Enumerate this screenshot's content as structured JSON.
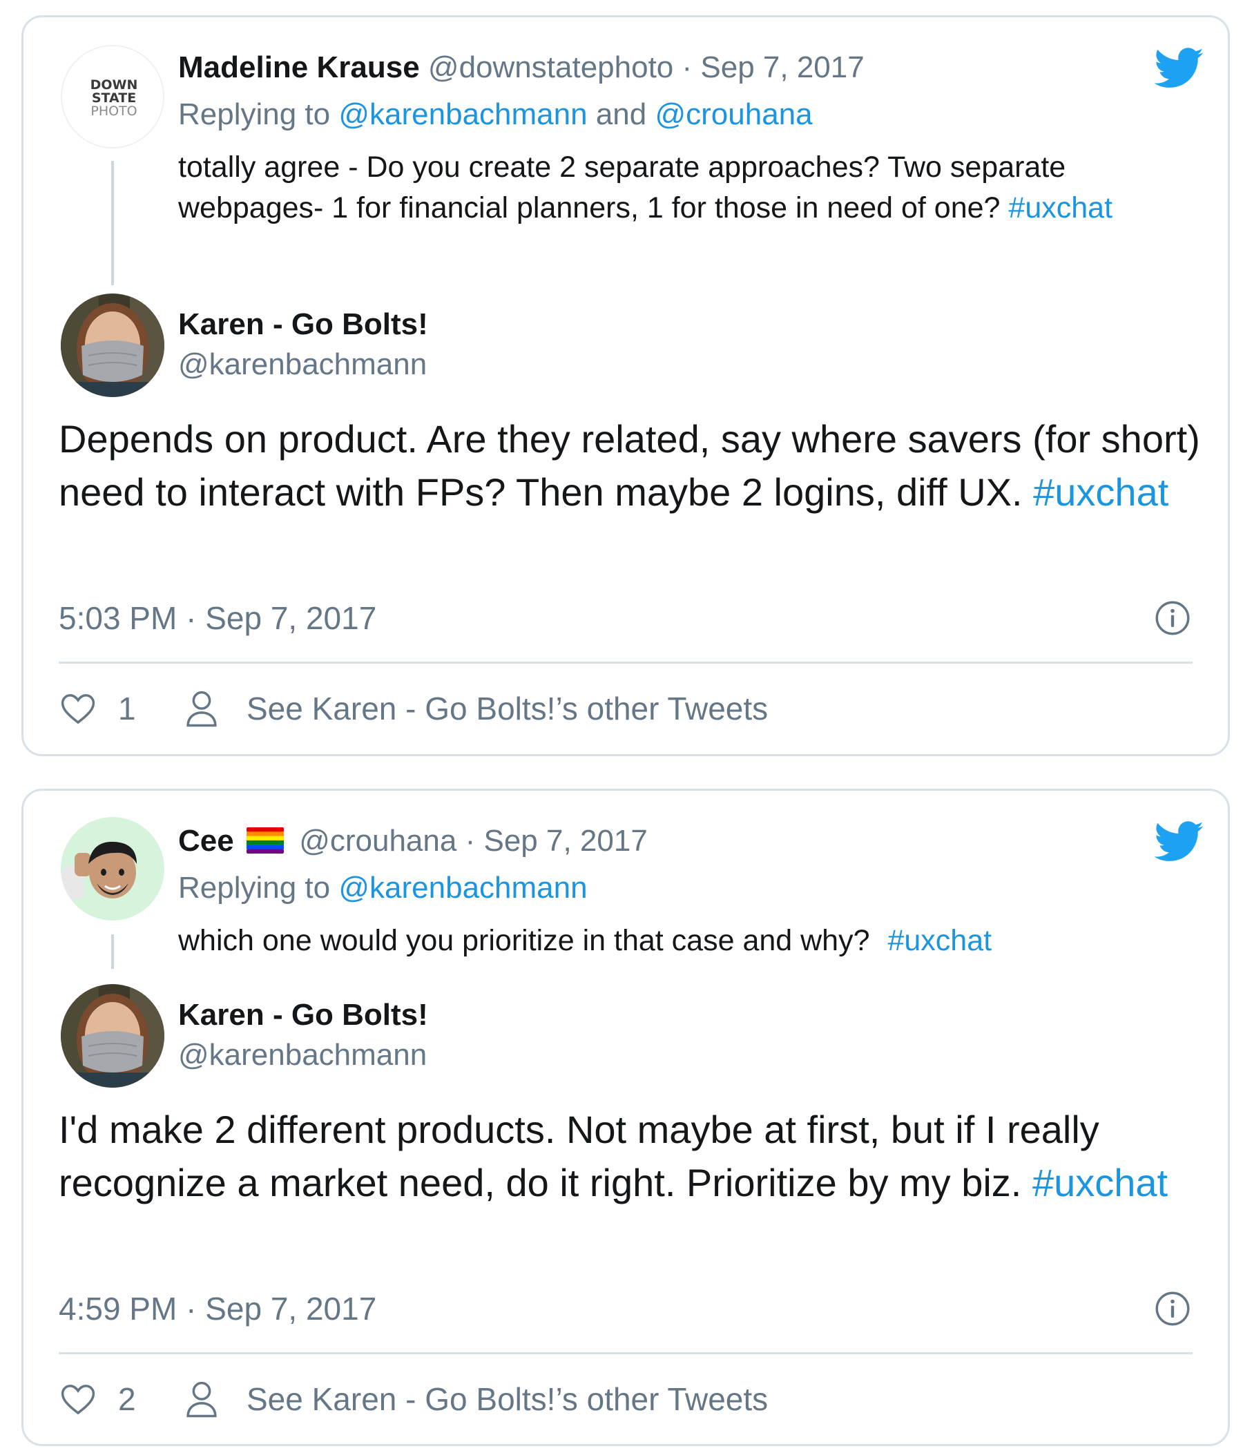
{
  "colors": {
    "link_blue": "#1b95e0",
    "muted_gray": "#657786",
    "text_dark": "#14171a",
    "border": "#d9e1e8",
    "twitter_blue": "#1da1f2"
  },
  "embeds": [
    {
      "parent": {
        "avatar_logo_lines": [
          "DOWN",
          "STATE",
          "PHOTO"
        ],
        "name": "Madeline Krause",
        "handle": "@downstatephoto",
        "separator": "·",
        "date": "Sep 7, 2017",
        "replying_prefix": "Replying to",
        "replying_handle_1": "@karenbachmann",
        "replying_and": "and",
        "replying_handle_2": "@crouhana",
        "text": "totally agree - Do you create 2 separate approaches? Two separate webpages- 1 for financial planners, 1 for those in need of one?",
        "hashtag": "#uxchat"
      },
      "tweet": {
        "name": "Karen - Go Bolts!",
        "handle": "@karenbachmann",
        "text": "Depends on product. Are they related, say where savers (for short) need to interact with FPs? Then maybe 2 logins, diff UX.",
        "hashtag": "#uxchat",
        "timestamp": "5:03 PM · Sep 7, 2017",
        "likes": "1",
        "see_other": "See Karen - Go Bolts!’s other Tweets"
      },
      "icons": {
        "brand": "twitter-bird-icon",
        "info": "info-icon",
        "like": "heart-icon",
        "profile": "person-icon"
      }
    },
    {
      "parent": {
        "name": "Cee",
        "flag_emoji": "rainbow-flag",
        "handle": "@crouhana",
        "separator": "·",
        "date": "Sep 7, 2017",
        "replying_prefix": "Replying to",
        "replying_handle_1": "@karenbachmann",
        "text": "which one would you prioritize in that case and why?",
        "hashtag": "#uxchat"
      },
      "tweet": {
        "name": "Karen - Go Bolts!",
        "handle": "@karenbachmann",
        "text": "I'd make 2 different products. Not maybe at first, but if I really recognize a market need, do it right. Prioritize by my biz.",
        "hashtag": "#uxchat",
        "timestamp": "4:59 PM · Sep 7, 2017",
        "likes": "2",
        "see_other": "See Karen - Go Bolts!’s other Tweets"
      },
      "icons": {
        "brand": "twitter-bird-icon",
        "info": "info-icon",
        "like": "heart-icon",
        "profile": "person-icon"
      }
    }
  ]
}
